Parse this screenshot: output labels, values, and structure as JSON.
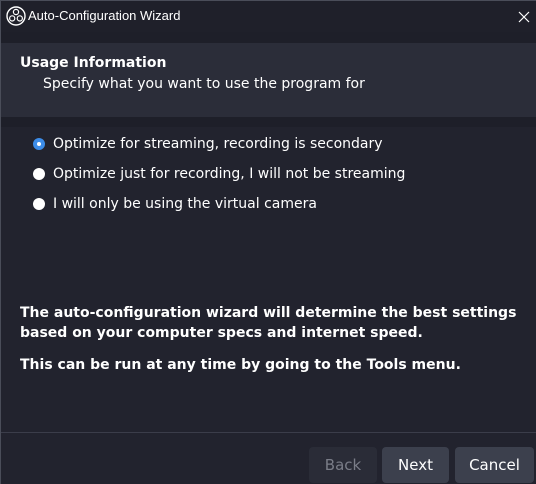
{
  "window": {
    "title": "Auto-Configuration Wizard",
    "app_icon": "obs-logo-icon",
    "close_icon": "close-icon"
  },
  "header": {
    "title": "Usage Information",
    "subtitle": "Specify what you want to use the program for"
  },
  "options": [
    {
      "label": "Optimize for streaming, recording is secondary",
      "checked": true
    },
    {
      "label": "Optimize just for recording, I will not be streaming",
      "checked": false
    },
    {
      "label": "I will only be using the virtual camera",
      "checked": false
    }
  ],
  "info": {
    "line1": "The auto-configuration wizard will determine the best settings based on your computer specs and internet speed.",
    "line2": "This can be run at any time by going to the Tools menu."
  },
  "buttons": {
    "back": "Back",
    "next": "Next",
    "cancel": "Cancel"
  },
  "colors": {
    "accent": "#3c8ce8",
    "background": "#1e1f29",
    "header_bg": "#2b2d39",
    "button_bg": "#3c404d"
  }
}
